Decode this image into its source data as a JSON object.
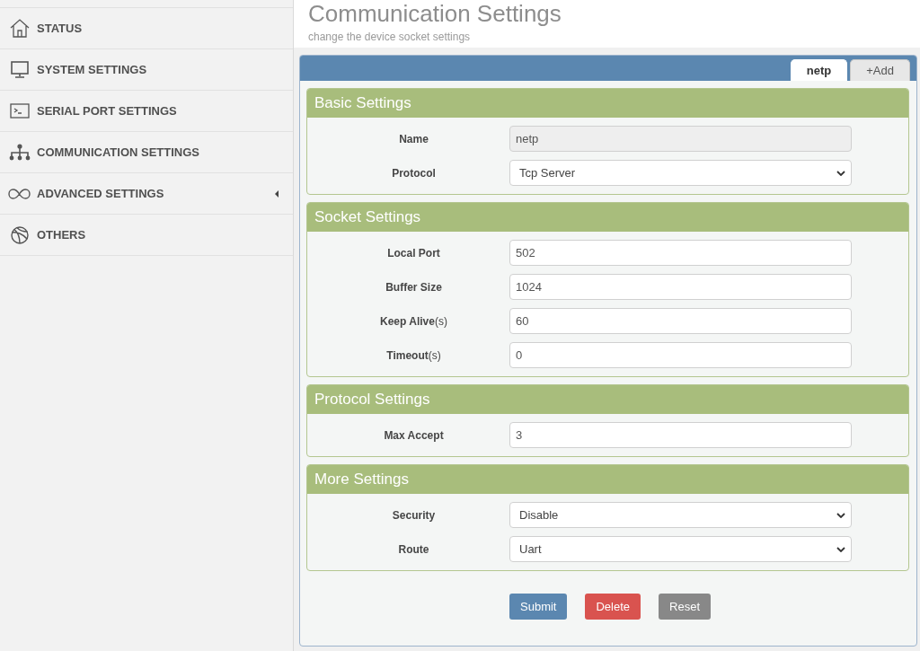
{
  "sidebar": {
    "items": [
      {
        "label": "STATUS"
      },
      {
        "label": "SYSTEM SETTINGS"
      },
      {
        "label": "SERIAL PORT SETTINGS"
      },
      {
        "label": "COMMUNICATION SETTINGS"
      },
      {
        "label": "ADVANCED SETTINGS",
        "expanded": false
      },
      {
        "label": "OTHERS"
      }
    ]
  },
  "header": {
    "title": "Communication Settings",
    "subtitle": "change the device socket settings"
  },
  "tabs": [
    {
      "label": "netp",
      "selected": true
    },
    {
      "label": "+Add",
      "selected": false
    }
  ],
  "sections": [
    {
      "title": "Basic Settings",
      "fields": [
        {
          "label": "Name",
          "kind": "text",
          "value": "netp",
          "disabled": true
        },
        {
          "label": "Protocol",
          "kind": "select",
          "value": "Tcp Server",
          "disabled": false
        }
      ]
    },
    {
      "title": "Socket Settings",
      "fields": [
        {
          "label": "Local Port",
          "kind": "text",
          "value": "502",
          "disabled": false
        },
        {
          "label": "Buffer Size",
          "kind": "text",
          "value": "1024",
          "disabled": false
        },
        {
          "label": "Keep Alive",
          "unit": "(s)",
          "kind": "text",
          "value": "60",
          "disabled": false
        },
        {
          "label": "Timeout",
          "unit": "(s)",
          "kind": "text",
          "value": "0",
          "disabled": false
        }
      ]
    },
    {
      "title": "Protocol Settings",
      "fields": [
        {
          "label": "Max Accept",
          "kind": "text",
          "value": "3",
          "disabled": false
        }
      ]
    },
    {
      "title": "More Settings",
      "fields": [
        {
          "label": "Security",
          "kind": "select",
          "value": "Disable",
          "disabled": false
        },
        {
          "label": "Route",
          "kind": "select",
          "value": "Uart",
          "disabled": false
        }
      ]
    }
  ],
  "buttons": [
    {
      "label": "Submit",
      "kind": "primary"
    },
    {
      "label": "Delete",
      "kind": "danger"
    },
    {
      "label": "Reset",
      "kind": "default"
    }
  ]
}
